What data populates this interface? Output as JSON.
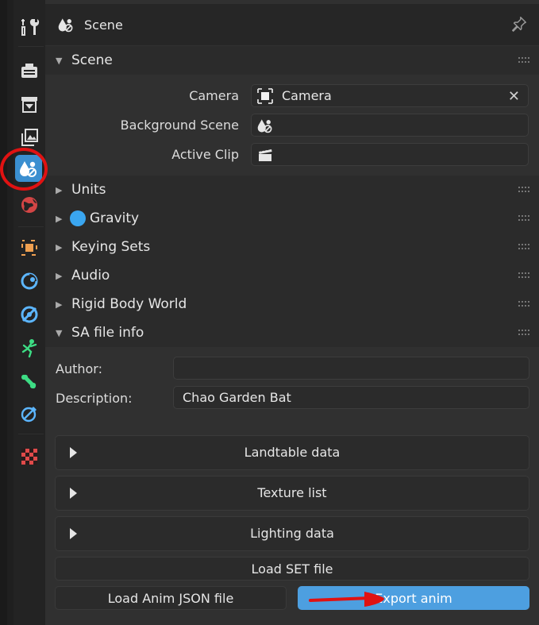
{
  "colors": {
    "accent": "#4d9fe0",
    "active_tab": "#3b8fd0",
    "annotation": "#e01212",
    "gravity_dot": "#3aa6f0"
  },
  "sidebar": {
    "tabs": [
      {
        "name": "tool",
        "icon": "tool-icon"
      },
      {
        "name": "render",
        "icon": "render-icon"
      },
      {
        "name": "output",
        "icon": "output-icon"
      },
      {
        "name": "view-layer",
        "icon": "view-layer-icon"
      },
      {
        "name": "scene",
        "icon": "scene-icon",
        "active": true
      },
      {
        "name": "world",
        "icon": "world-icon"
      },
      {
        "name": "object",
        "icon": "object-icon"
      },
      {
        "name": "modifiers",
        "icon": "wrench-modifier-icon"
      },
      {
        "name": "physics",
        "icon": "physics-icon"
      },
      {
        "name": "object-data",
        "icon": "armature-pose-icon"
      },
      {
        "name": "bone",
        "icon": "bone-icon"
      },
      {
        "name": "bone-constraints",
        "icon": "bone-constraint-icon"
      },
      {
        "name": "texture",
        "icon": "texture-checker-icon"
      }
    ]
  },
  "header": {
    "title": "Scene"
  },
  "scene_section": {
    "label": "Scene",
    "camera_label": "Camera",
    "camera_value": "Camera",
    "background_scene_label": "Background Scene",
    "background_scene_value": "",
    "active_clip_label": "Active Clip",
    "active_clip_value": ""
  },
  "collapsed_sections": {
    "units": "Units",
    "gravity": "Gravity",
    "keying_sets": "Keying Sets",
    "audio": "Audio",
    "rigid_body_world": "Rigid Body World"
  },
  "sa_file_info": {
    "label": "SA file info",
    "author_label": "Author:",
    "author_value": "",
    "description_label": "Description:",
    "description_value": "Chao Garden Bat",
    "subpanels": {
      "landtable": "Landtable data",
      "texture_list": "Texture list",
      "lighting": "Lighting data"
    },
    "load_set_label": "Load SET file",
    "load_anim_label": "Load Anim JSON file",
    "export_anim_label": "Export anim"
  }
}
